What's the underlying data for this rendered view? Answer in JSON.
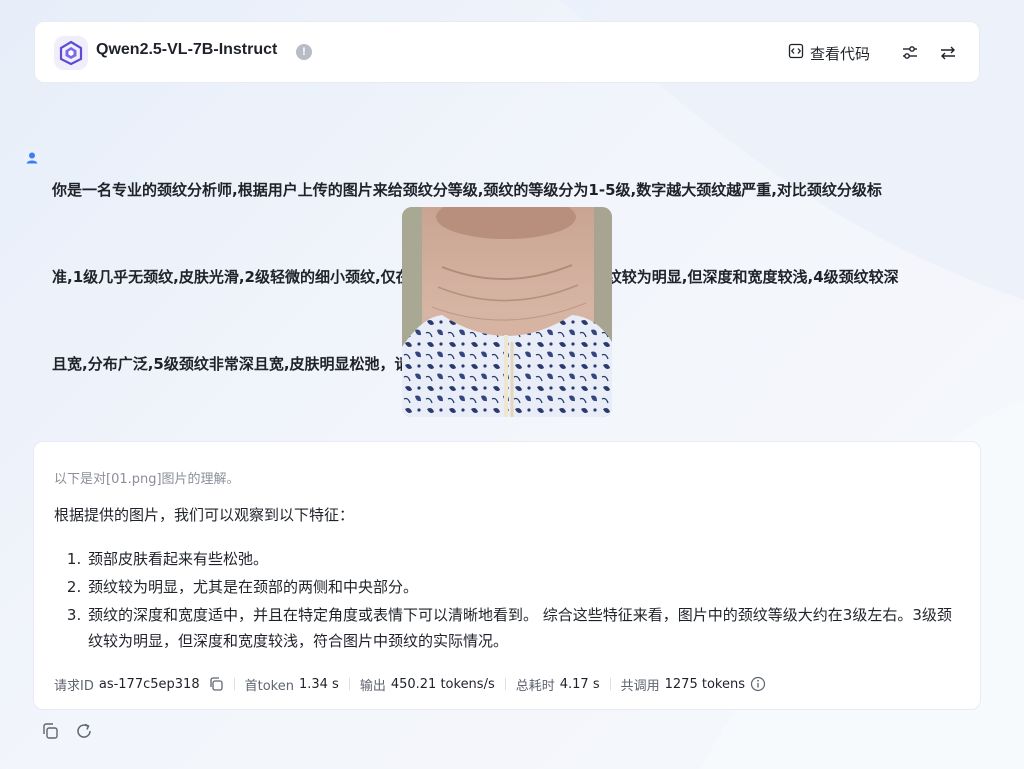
{
  "header": {
    "model_name": "Qwen2.5-VL-7B-Instruct",
    "view_code_label": "查看代码",
    "icons": [
      "code-icon",
      "settings-sliders-icon",
      "swap-icon",
      "info-icon"
    ]
  },
  "user_message": {
    "lines": [
      "你是一名专业的颈纹分析师,根据用户上传的图片来给颈纹分等级,颈纹的等级分为1-5级,数字越大颈纹越严重,对比颈纹分级标",
      "准,1级几乎无颈纹,皮肤光滑,2级轻微的细小颈纹,仅在特定角度或表情下可见,3级颈纹较为明显,但深度和宽度较浅,4级颈纹较深",
      "且宽,分布广泛,5级颈纹非常深且宽,皮肤明显松弛，请识别出图片中的颈纹等级"
    ]
  },
  "answer": {
    "note": "以下是对[01.png]图片的理解。",
    "intro": "根据提供的图片，我们可以观察到以下特征：",
    "items": [
      "颈部皮肤看起来有些松弛。",
      "颈纹较为明显，尤其是在颈部的两侧和中央部分。",
      "颈纹的深度和宽度适中，并且在特定角度或表情下可以清晰地看到。 综合这些特征来看，图片中的颈纹等级大约在3级左右。3级颈纹较为明显，但深度和宽度较浅，符合图片中颈纹的实际情况。"
    ]
  },
  "metrics": {
    "request_id_label": "请求ID",
    "request_id": "as-177c5ep318",
    "first_token_label": "首token",
    "first_token": "1.34 s",
    "output_label": "输出",
    "output": "450.21 tokens/s",
    "total_time_label": "总耗时",
    "total_time": "4.17 s",
    "usage_label": "共调用",
    "usage": "1275 tokens"
  },
  "colors": {
    "accent": "#5b4bd6",
    "user_icon": "#3c7df2",
    "background": "#eef2f9"
  }
}
